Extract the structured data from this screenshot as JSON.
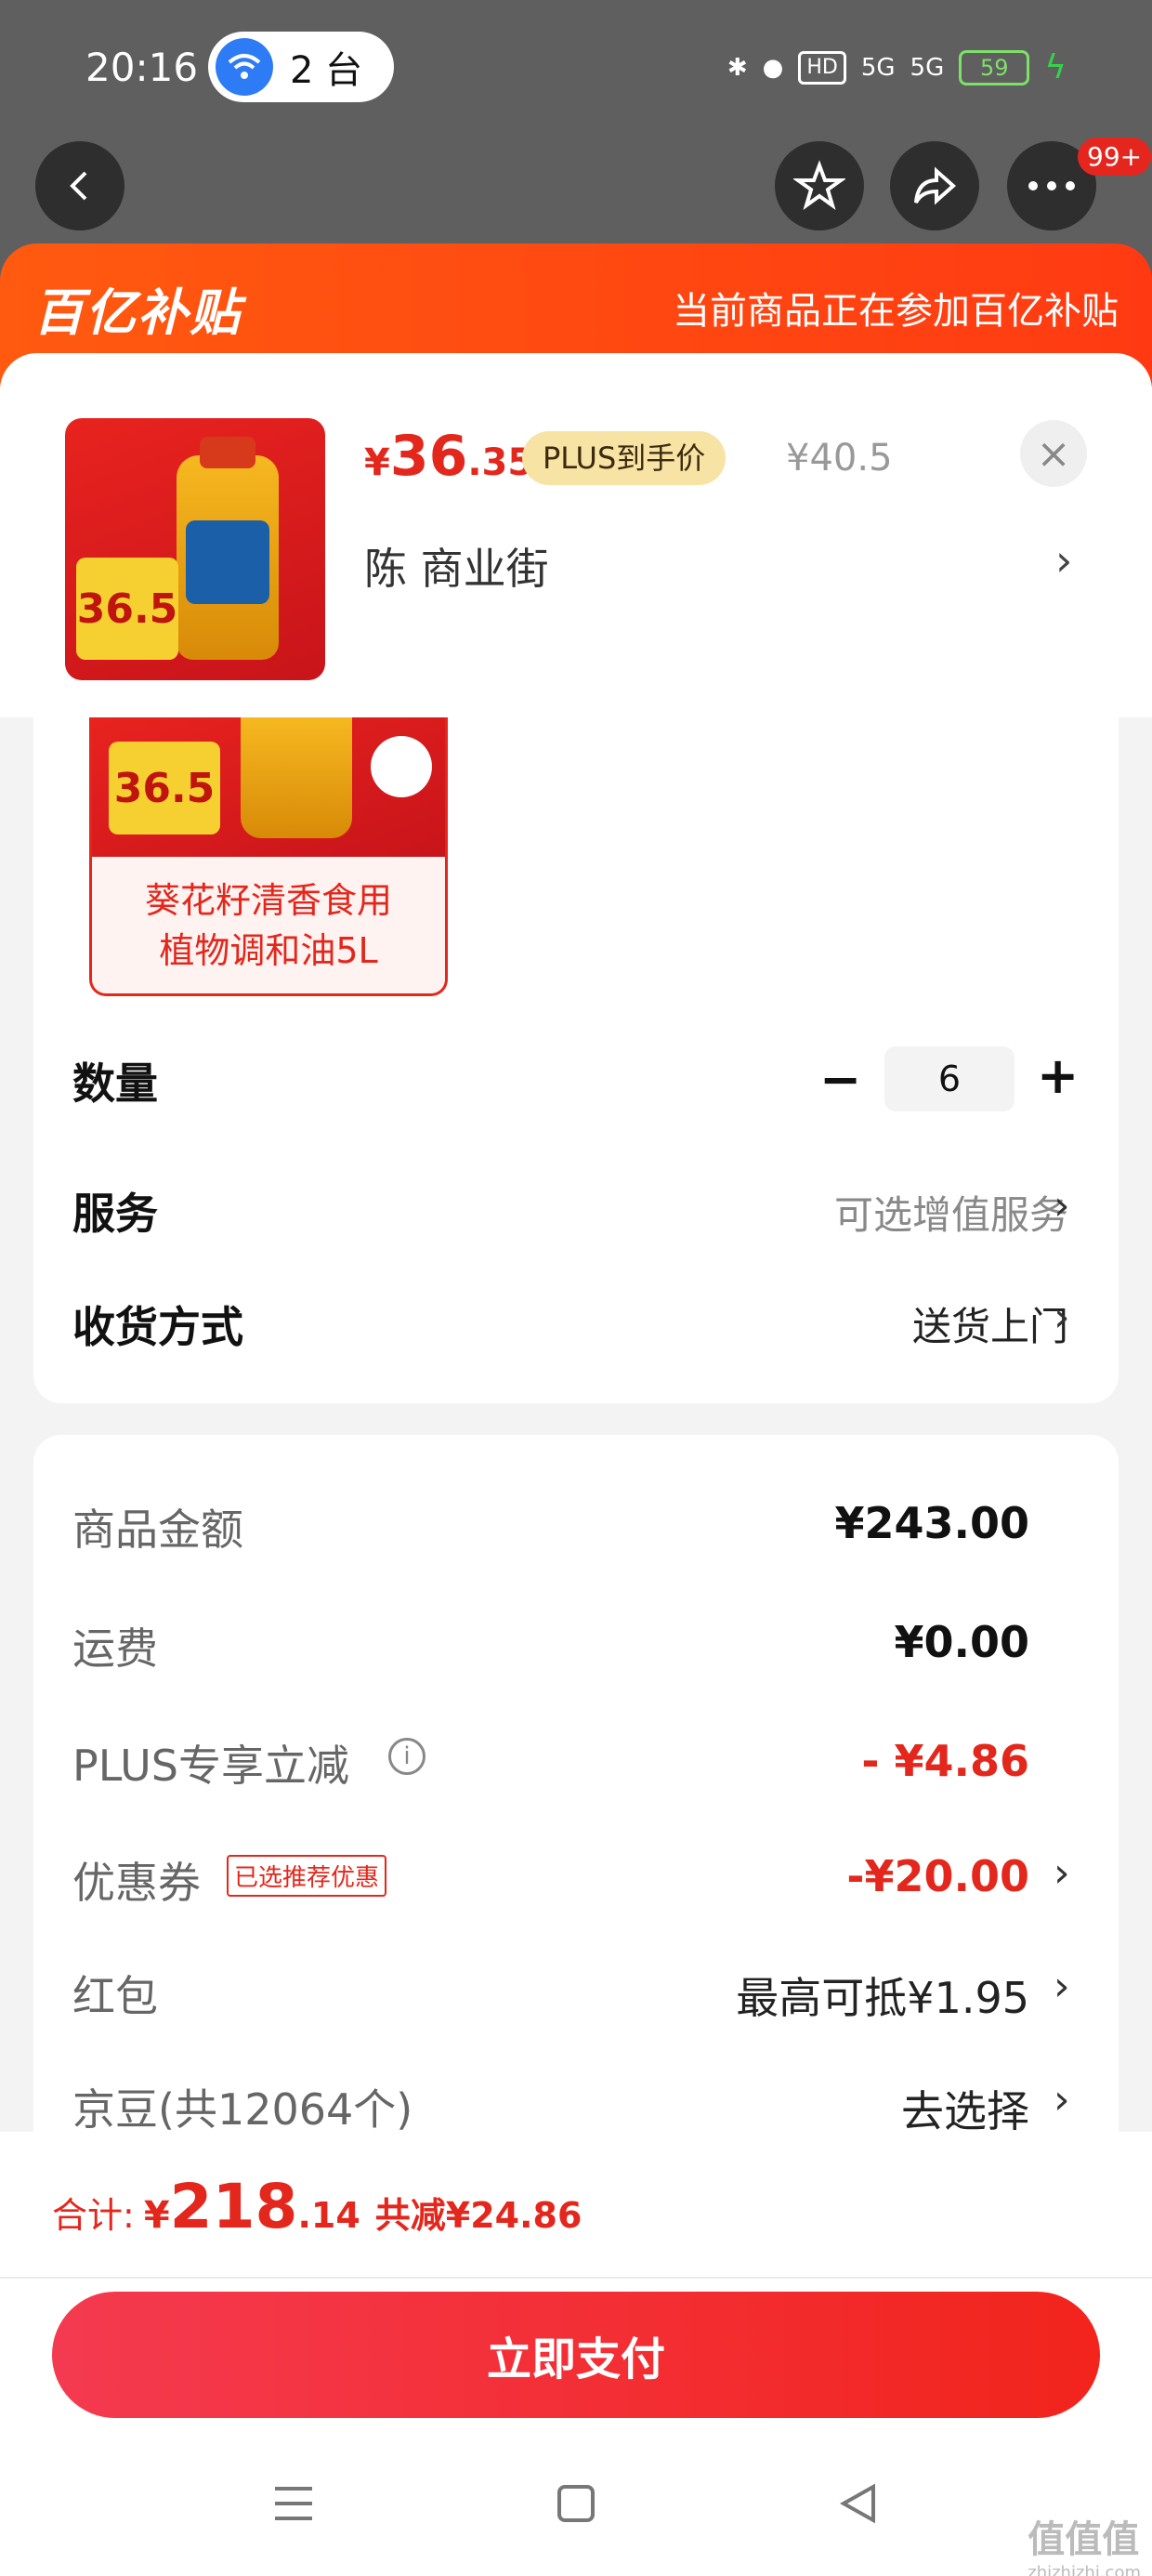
{
  "status_bar": {
    "time": "20:16",
    "device_count": "2 台",
    "hd_label": "HD",
    "net1": "5G",
    "net2": "5G",
    "battery": "59"
  },
  "nav": {
    "more_badge": "99+"
  },
  "banner": {
    "logo": "百亿补贴",
    "text": "当前商品正在参加百亿补贴"
  },
  "product": {
    "price_currency": "¥",
    "price_int": "36",
    "price_dec": ".35",
    "plus_tag": "PLUS到手价",
    "original_price": "¥40.5",
    "address": "陈  商业街",
    "thumb_tag": "36.5"
  },
  "spec": {
    "tag": "36.5",
    "name_line1": "葵花籽清香食用",
    "name_line2": "植物调和油5L"
  },
  "options": {
    "quantity_label": "数量",
    "quantity_value": "6",
    "service_label": "服务",
    "service_value": "可选增值服务",
    "delivery_label": "收货方式",
    "delivery_value": "送货上门"
  },
  "pricing": {
    "goods_label": "商品金额",
    "goods_value": "¥243.00",
    "shipping_label": "运费",
    "shipping_value": "¥0.00",
    "plus_label": "PLUS专享立减",
    "plus_value": "- ¥4.86",
    "coupon_label": "优惠券",
    "coupon_tag": "已选推荐优惠",
    "coupon_value": "-¥20.00",
    "redpacket_label": "红包",
    "redpacket_value": "最高可抵¥1.95",
    "jingdou_label": "京豆(共12064个)",
    "jingdou_value": "去选择"
  },
  "footer": {
    "total_label": "合计:",
    "total_currency": "¥",
    "total_int": "218",
    "total_dec": ".14",
    "total_saved": "共减¥24.86",
    "pay_button": "立即支付"
  },
  "watermark": {
    "text": "值值值",
    "sub": "zhizhizhi.com"
  }
}
